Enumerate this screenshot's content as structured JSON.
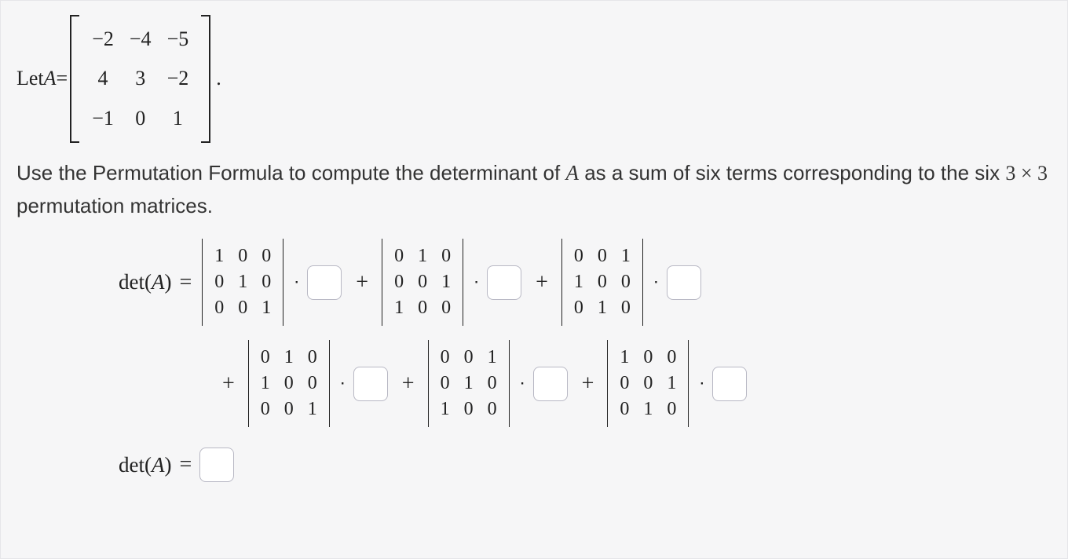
{
  "intro": {
    "let_text": "Let ",
    "A_symbol": "A",
    "equals": " = ",
    "period": "."
  },
  "matrix_A": [
    [
      "−2",
      "−4",
      "−5"
    ],
    [
      "4",
      "3",
      "−2"
    ],
    [
      "−1",
      "0",
      "1"
    ]
  ],
  "instruction": {
    "part1": "Use the Permutation Formula to compute the determinant of ",
    "A_symbol": "A",
    "part2": " as a sum of six terms corresponding to the six ",
    "dims": "3 × 3",
    "part3": " permutation matrices."
  },
  "labels": {
    "det": "det",
    "A": "A",
    "open": "(",
    "close": ")",
    "equals": "=",
    "plus": "+",
    "dot": "⋅"
  },
  "perm_matrices": [
    [
      [
        "1",
        "0",
        "0"
      ],
      [
        "0",
        "1",
        "0"
      ],
      [
        "0",
        "0",
        "1"
      ]
    ],
    [
      [
        "0",
        "1",
        "0"
      ],
      [
        "0",
        "0",
        "1"
      ],
      [
        "1",
        "0",
        "0"
      ]
    ],
    [
      [
        "0",
        "0",
        "1"
      ],
      [
        "1",
        "0",
        "0"
      ],
      [
        "0",
        "1",
        "0"
      ]
    ],
    [
      [
        "0",
        "1",
        "0"
      ],
      [
        "1",
        "0",
        "0"
      ],
      [
        "0",
        "0",
        "1"
      ]
    ],
    [
      [
        "0",
        "0",
        "1"
      ],
      [
        "0",
        "1",
        "0"
      ],
      [
        "1",
        "0",
        "0"
      ]
    ],
    [
      [
        "1",
        "0",
        "0"
      ],
      [
        "0",
        "0",
        "1"
      ],
      [
        "0",
        "1",
        "0"
      ]
    ]
  ],
  "answers": {
    "term1": "",
    "term2": "",
    "term3": "",
    "term4": "",
    "term5": "",
    "term6": "",
    "final": ""
  }
}
